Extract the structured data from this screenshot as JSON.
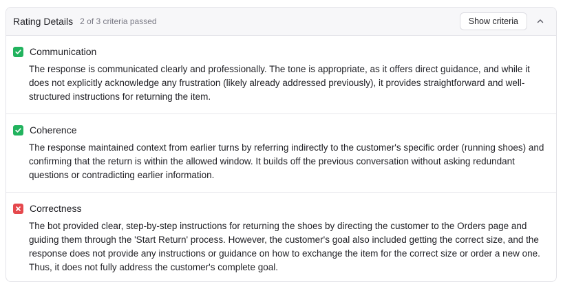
{
  "header": {
    "title": "Rating Details",
    "subtitle": "2 of 3 criteria passed",
    "show_criteria_label": "Show criteria",
    "collapse_icon": "chevron-up-icon"
  },
  "criteria": [
    {
      "name": "Communication",
      "status": "pass",
      "status_icon": "check-icon",
      "color": "#22b35e",
      "text": "The response is communicated clearly and professionally. The tone is appropriate, as it offers direct guidance, and while it does not explicitly acknowledge any frustration (likely already addressed previously), it provides straightforward and well-structured instructions for returning the item."
    },
    {
      "name": "Coherence",
      "status": "pass",
      "status_icon": "check-icon",
      "color": "#22b35e",
      "text": "The response maintained context from earlier turns by referring indirectly to the customer's specific order (running shoes) and confirming that the return is within the allowed window. It builds off the previous conversation without asking redundant questions or contradicting earlier information."
    },
    {
      "name": "Correctness",
      "status": "fail",
      "status_icon": "x-icon",
      "color": "#e5484d",
      "text": "The bot provided clear, step-by-step instructions for returning the shoes by directing the customer to the Orders page and guiding them through the 'Start Return' process. However, the customer's goal also included getting the correct size, and the response does not provide any instructions or guidance on how to exchange the item for the correct size or order a new one. Thus, it does not fully address the customer's complete goal."
    }
  ]
}
